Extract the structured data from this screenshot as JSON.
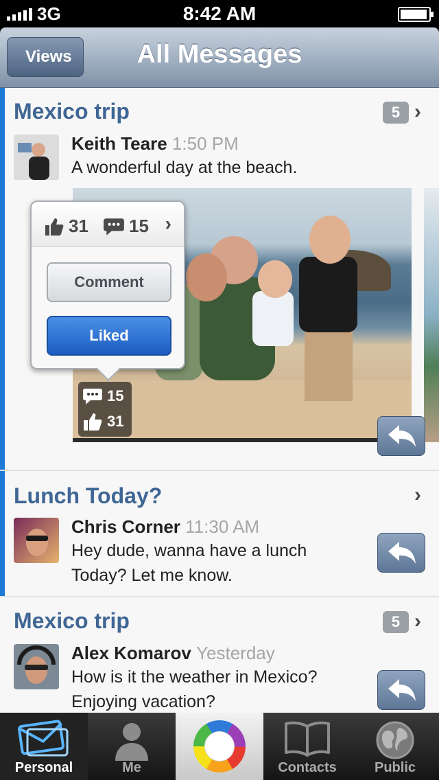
{
  "status_bar": {
    "carrier": "3G",
    "time": "8:42 AM"
  },
  "nav": {
    "back_label": "Views",
    "title": "All Messages"
  },
  "threads": [
    {
      "title": "Mexico trip",
      "count": "5",
      "sender": "Keith Teare",
      "time": "1:50 PM",
      "message": "A wonderful day at the beach.",
      "photo": {
        "comments": "15",
        "likes": "31"
      },
      "popover": {
        "likes": "31",
        "comments": "15",
        "comment_label": "Comment",
        "liked_label": "Liked"
      }
    },
    {
      "title": "Lunch Today?",
      "sender": "Chris Corner",
      "time": "11:30 AM",
      "message_line1": "Hey dude, wanna have a lunch",
      "message_line2": "Today? Let me know."
    },
    {
      "title": "Mexico trip",
      "count": "5",
      "sender": "Alex Komarov",
      "time": "Yesterday",
      "message_line1": "How is it the weather in Mexico?",
      "message_line2": "Enjoying vacation?"
    }
  ],
  "tabs": [
    {
      "label": "Personal",
      "icon": "envelopes-icon",
      "active": true
    },
    {
      "label": "Me",
      "icon": "person-icon"
    },
    {
      "label": "",
      "icon": "color-ring-icon"
    },
    {
      "label": "Contacts",
      "icon": "book-icon"
    },
    {
      "label": "Public",
      "icon": "globe-icon"
    }
  ]
}
